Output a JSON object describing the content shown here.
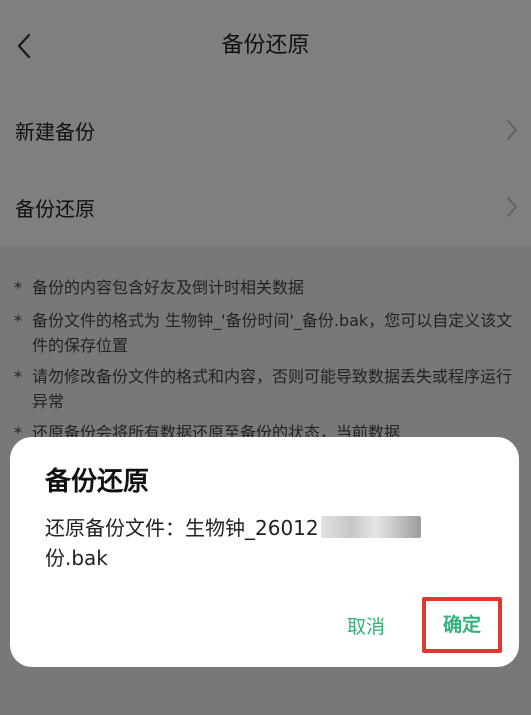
{
  "header": {
    "title": "备份还原",
    "back_icon": "chevron-left-icon"
  },
  "menu": {
    "items": [
      {
        "label": "新建备份",
        "icon": "chevron-right-icon"
      },
      {
        "label": "备份还原",
        "icon": "chevron-right-icon"
      }
    ]
  },
  "notes": {
    "bullet": "*",
    "items": [
      "备份的内容包含好友及倒计时相关数据",
      "备份文件的格式为 生物钟_'备份时间'_备份.bak，您可以自定义该文件的保存位置",
      "请勿修改备份文件的格式和内容，否则可能导致数据丢失或程序运行异常",
      "还原备份会将所有数据还原至备份的状态，当前数据"
    ]
  },
  "dialog": {
    "title": "备份还原",
    "message_prefix": "还原备份文件：生物钟_26012",
    "message_suffix": "份.bak",
    "cancel_label": "取消",
    "confirm_label": "确定"
  },
  "colors": {
    "accent": "#34b27b",
    "highlight": "#e2372e",
    "overlay": "rgba(0,0,0,0.5)"
  }
}
